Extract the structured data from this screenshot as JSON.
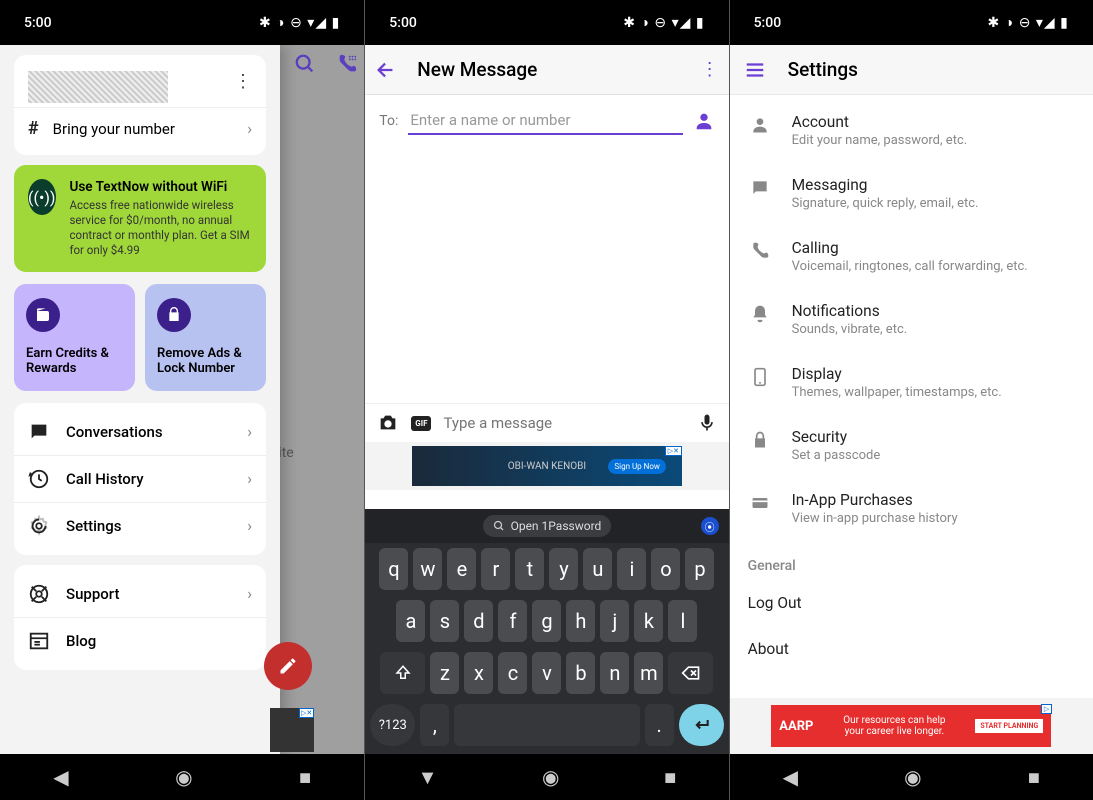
{
  "status": {
    "time": "5:00"
  },
  "phone1": {
    "bringNumber": "Bring your number",
    "promo": {
      "title": "Use TextNow without WiFi",
      "sub": "Access free nationwide wireless service for $0/month, no annual contract or monthly plan. Get a SIM for only $4.99"
    },
    "card1": "Earn Credits & Rewards",
    "card2": "Remove Ads & Lock Number",
    "menu1": [
      {
        "label": "Conversations"
      },
      {
        "label": "Call History"
      },
      {
        "label": "Settings"
      }
    ],
    "menu2": [
      {
        "label": "Support"
      },
      {
        "label": "Blog"
      }
    ],
    "bgText": "ite"
  },
  "phone2": {
    "title": "New Message",
    "toLabel": "To:",
    "toPlaceholder": "Enter a name or number",
    "msgPlaceholder": "Type a message",
    "adText": "OBI-WAN KENOBI",
    "adBtn": "Sign Up Now",
    "pw": "Open 1Password",
    "numKey": "?123",
    "rows": {
      "r1": [
        "q",
        "w",
        "e",
        "r",
        "t",
        "y",
        "u",
        "i",
        "o",
        "p"
      ],
      "r2": [
        "a",
        "s",
        "d",
        "f",
        "g",
        "h",
        "j",
        "k",
        "l"
      ],
      "r3": [
        "z",
        "x",
        "c",
        "v",
        "b",
        "n",
        "m"
      ]
    }
  },
  "phone3": {
    "title": "Settings",
    "items": [
      {
        "t": "Account",
        "s": "Edit your name, password, etc."
      },
      {
        "t": "Messaging",
        "s": "Signature, quick reply, email, etc."
      },
      {
        "t": "Calling",
        "s": "Voicemail, ringtones, call forwarding, etc."
      },
      {
        "t": "Notifications",
        "s": "Sounds, vibrate, etc."
      },
      {
        "t": "Display",
        "s": "Themes, wallpaper, timestamps, etc."
      },
      {
        "t": "Security",
        "s": "Set a passcode"
      },
      {
        "t": "In-App Purchases",
        "s": "View in-app purchase history"
      }
    ],
    "generalHdr": "General",
    "logout": "Log Out",
    "about": "About",
    "ad": {
      "logo": "AARP",
      "text1": "Our resources can help",
      "text2": "your career live longer.",
      "btn": "START PLANNING"
    }
  }
}
